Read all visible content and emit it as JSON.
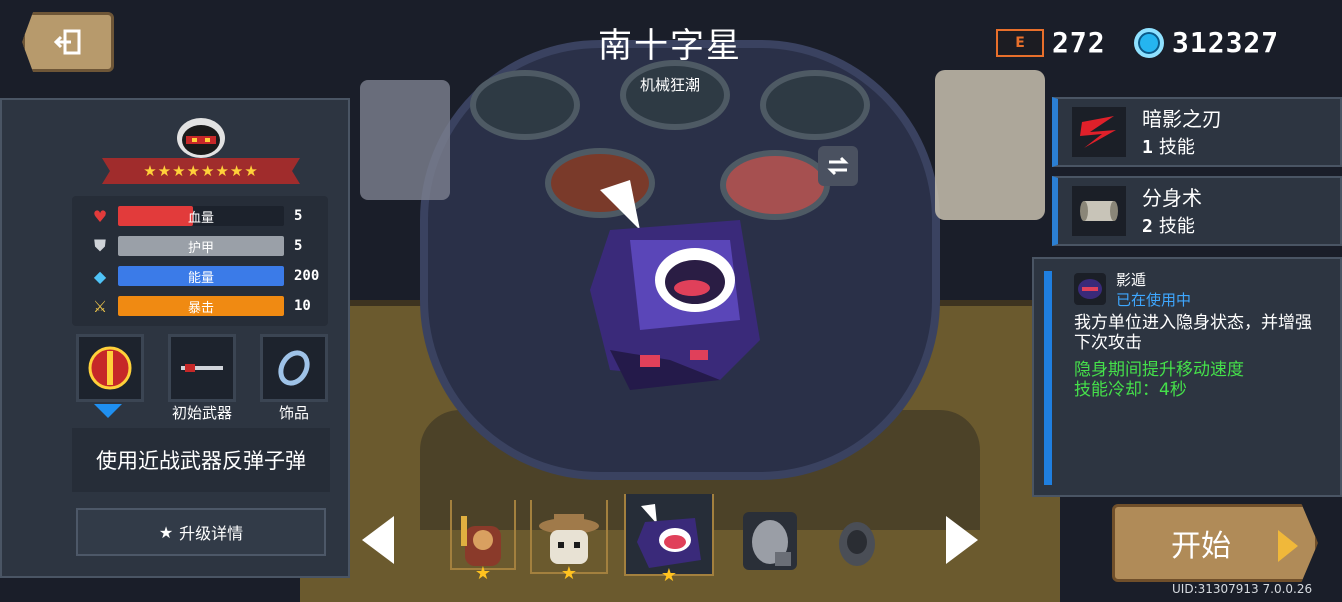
{
  "header": {
    "back_icon": "exit-door-icon",
    "title": "南十字星",
    "subtitle": "机械狂潮"
  },
  "currency": {
    "card_icon_label": "E",
    "card_count": "272",
    "gem_icon": "gem-icon",
    "gem_count": "312327"
  },
  "character": {
    "rank_stars": "★★★★★★★★",
    "stats": [
      {
        "name": "血量",
        "value": "5",
        "fill_fraction": 0.45,
        "color": "#e23b3b",
        "icon": "heart-icon"
      },
      {
        "name": "护甲",
        "value": "5",
        "fill_fraction": 1.0,
        "color": "#9aa0a8",
        "icon": "shield-icon"
      },
      {
        "name": "能量",
        "value": "200",
        "fill_fraction": 1.0,
        "color": "#3b7be8",
        "icon": "energy-crystal-icon"
      },
      {
        "name": "暴击",
        "value": "10",
        "fill_fraction": 1.0,
        "color": "#f08a12",
        "icon": "crit-sword-icon"
      }
    ],
    "equipment": {
      "weapon_label": "初始武器",
      "accessory_label": "饰品"
    },
    "passive": "使用近战武器反弹子弹",
    "upgrade_label": "升级详情"
  },
  "skills": [
    {
      "name": "暗影之刃",
      "slot": "1",
      "type": "技能",
      "icon": "shadow-blade-icon"
    },
    {
      "name": "分身术",
      "slot": "2",
      "type": "技能",
      "icon": "scroll-icon"
    }
  ],
  "skill_detail": {
    "name": "影遁",
    "status": "已在使用中",
    "description": "我方单位进入隐身状态，并增强下次攻击",
    "bonus_1": "隐身期间提升移动速度",
    "bonus_2": "技能冷却：4秒"
  },
  "start_label": "开始",
  "uid_text": "UID:31307913 7.0.0.26",
  "colors": {
    "panel": "#2d3541",
    "accent_blue": "#2b7fd3",
    "start_button": "#b08b58",
    "highlight_green": "#45e04a"
  }
}
